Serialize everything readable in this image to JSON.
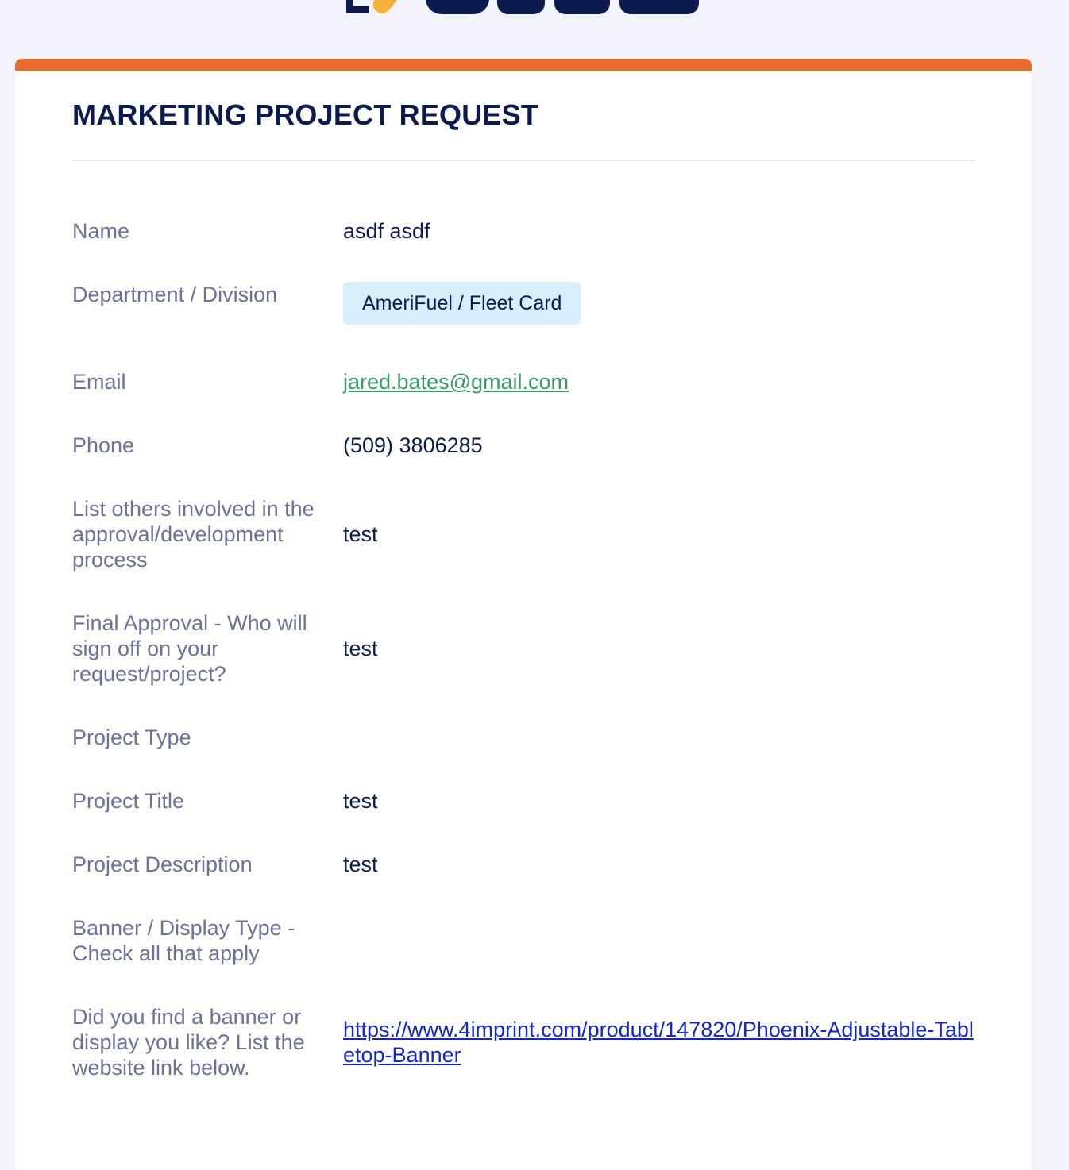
{
  "colors": {
    "accent_bar": "#e96b2e",
    "title": "#0b1b4d",
    "label": "#6b7299",
    "tag_bg": "#d8eefb",
    "email_link": "#3a9a63",
    "url_link": "#1326cf"
  },
  "form": {
    "title": "MARKETING PROJECT REQUEST",
    "fields": {
      "name": {
        "label": "Name",
        "value": "asdf asdf"
      },
      "department": {
        "label": "Department / Division",
        "value": "AmeriFuel / Fleet Card"
      },
      "email": {
        "label": "Email",
        "value": "jared.bates@gmail.com"
      },
      "phone": {
        "label": "Phone",
        "value": "(509) 3806285"
      },
      "others_involved": {
        "label": "List others involved in the approval/development process",
        "value": "test"
      },
      "final_approval": {
        "label": "Final Approval - Who will sign off on your request/project?",
        "value": "test"
      },
      "project_type": {
        "label": "Project Type",
        "value": ""
      },
      "project_title": {
        "label": "Project Title",
        "value": "test"
      },
      "project_description": {
        "label": "Project Description",
        "value": "test"
      },
      "banner_display_type": {
        "label": "Banner / Display Type - Check all that apply",
        "value": ""
      },
      "banner_link": {
        "label": "Did you find a banner or display you like? List the website link below.",
        "value": "https://www.4imprint.com/product/147820/Phoenix-Adjustable-Tabletop-Banner"
      }
    }
  }
}
